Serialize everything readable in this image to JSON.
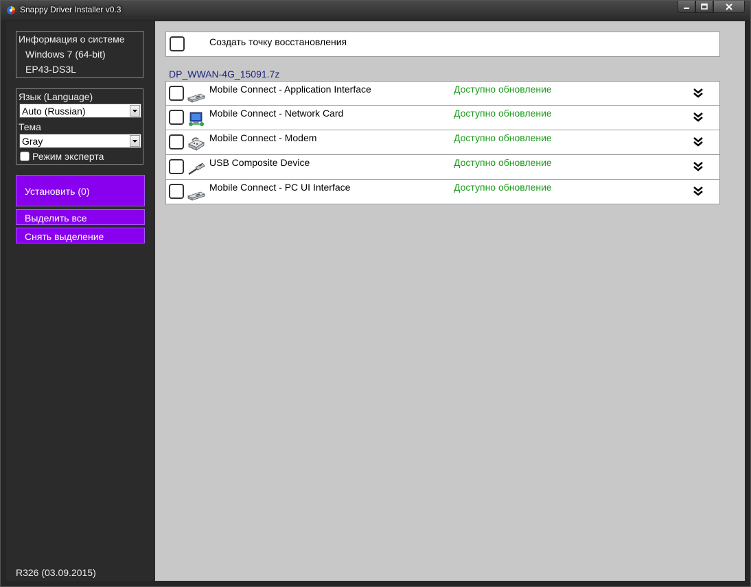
{
  "window": {
    "title": "Snappy Driver Installer v0.3",
    "controls": [
      "minimize",
      "maximize",
      "close"
    ]
  },
  "sidebar": {
    "system_info": {
      "heading": "Информация о системе",
      "os": "Windows 7 (64-bit)",
      "motherboard": "EP43-DS3L"
    },
    "language": {
      "label": "Язык (Language)",
      "selected": "Auto (Russian)"
    },
    "theme": {
      "label": "Тема",
      "selected": "Gray"
    },
    "expert_mode": {
      "label": "Режим эксперта",
      "checked": false
    },
    "buttons": {
      "install": "Установить (0)",
      "select_all": "Выделить все",
      "deselect": "Снять выделение"
    },
    "revision": "R326 (03.09.2015)"
  },
  "main": {
    "restore_point": {
      "label": "Создать точку восстановления",
      "checked": false
    },
    "driver_pack": "DP_WWAN-4G_15091.7z",
    "drivers": [
      {
        "name": "Mobile Connect - Application Interface",
        "status": "Доступно обновление",
        "icon": "port-icon"
      },
      {
        "name": "Mobile Connect - Network Card",
        "status": "Доступно обновление",
        "icon": "network-card-icon"
      },
      {
        "name": "Mobile Connect - Modem",
        "status": "Доступно обновление",
        "icon": "modem-icon"
      },
      {
        "name": "USB Composite Device",
        "status": "Доступно обновление",
        "icon": "usb-icon"
      },
      {
        "name": "Mobile Connect - PC UI Interface",
        "status": "Доступно обновление",
        "icon": "port-icon"
      }
    ]
  },
  "colors": {
    "accent_purple": "#8800ee",
    "status_green": "#1a9a1a",
    "pack_name_blue": "#1a237e"
  }
}
